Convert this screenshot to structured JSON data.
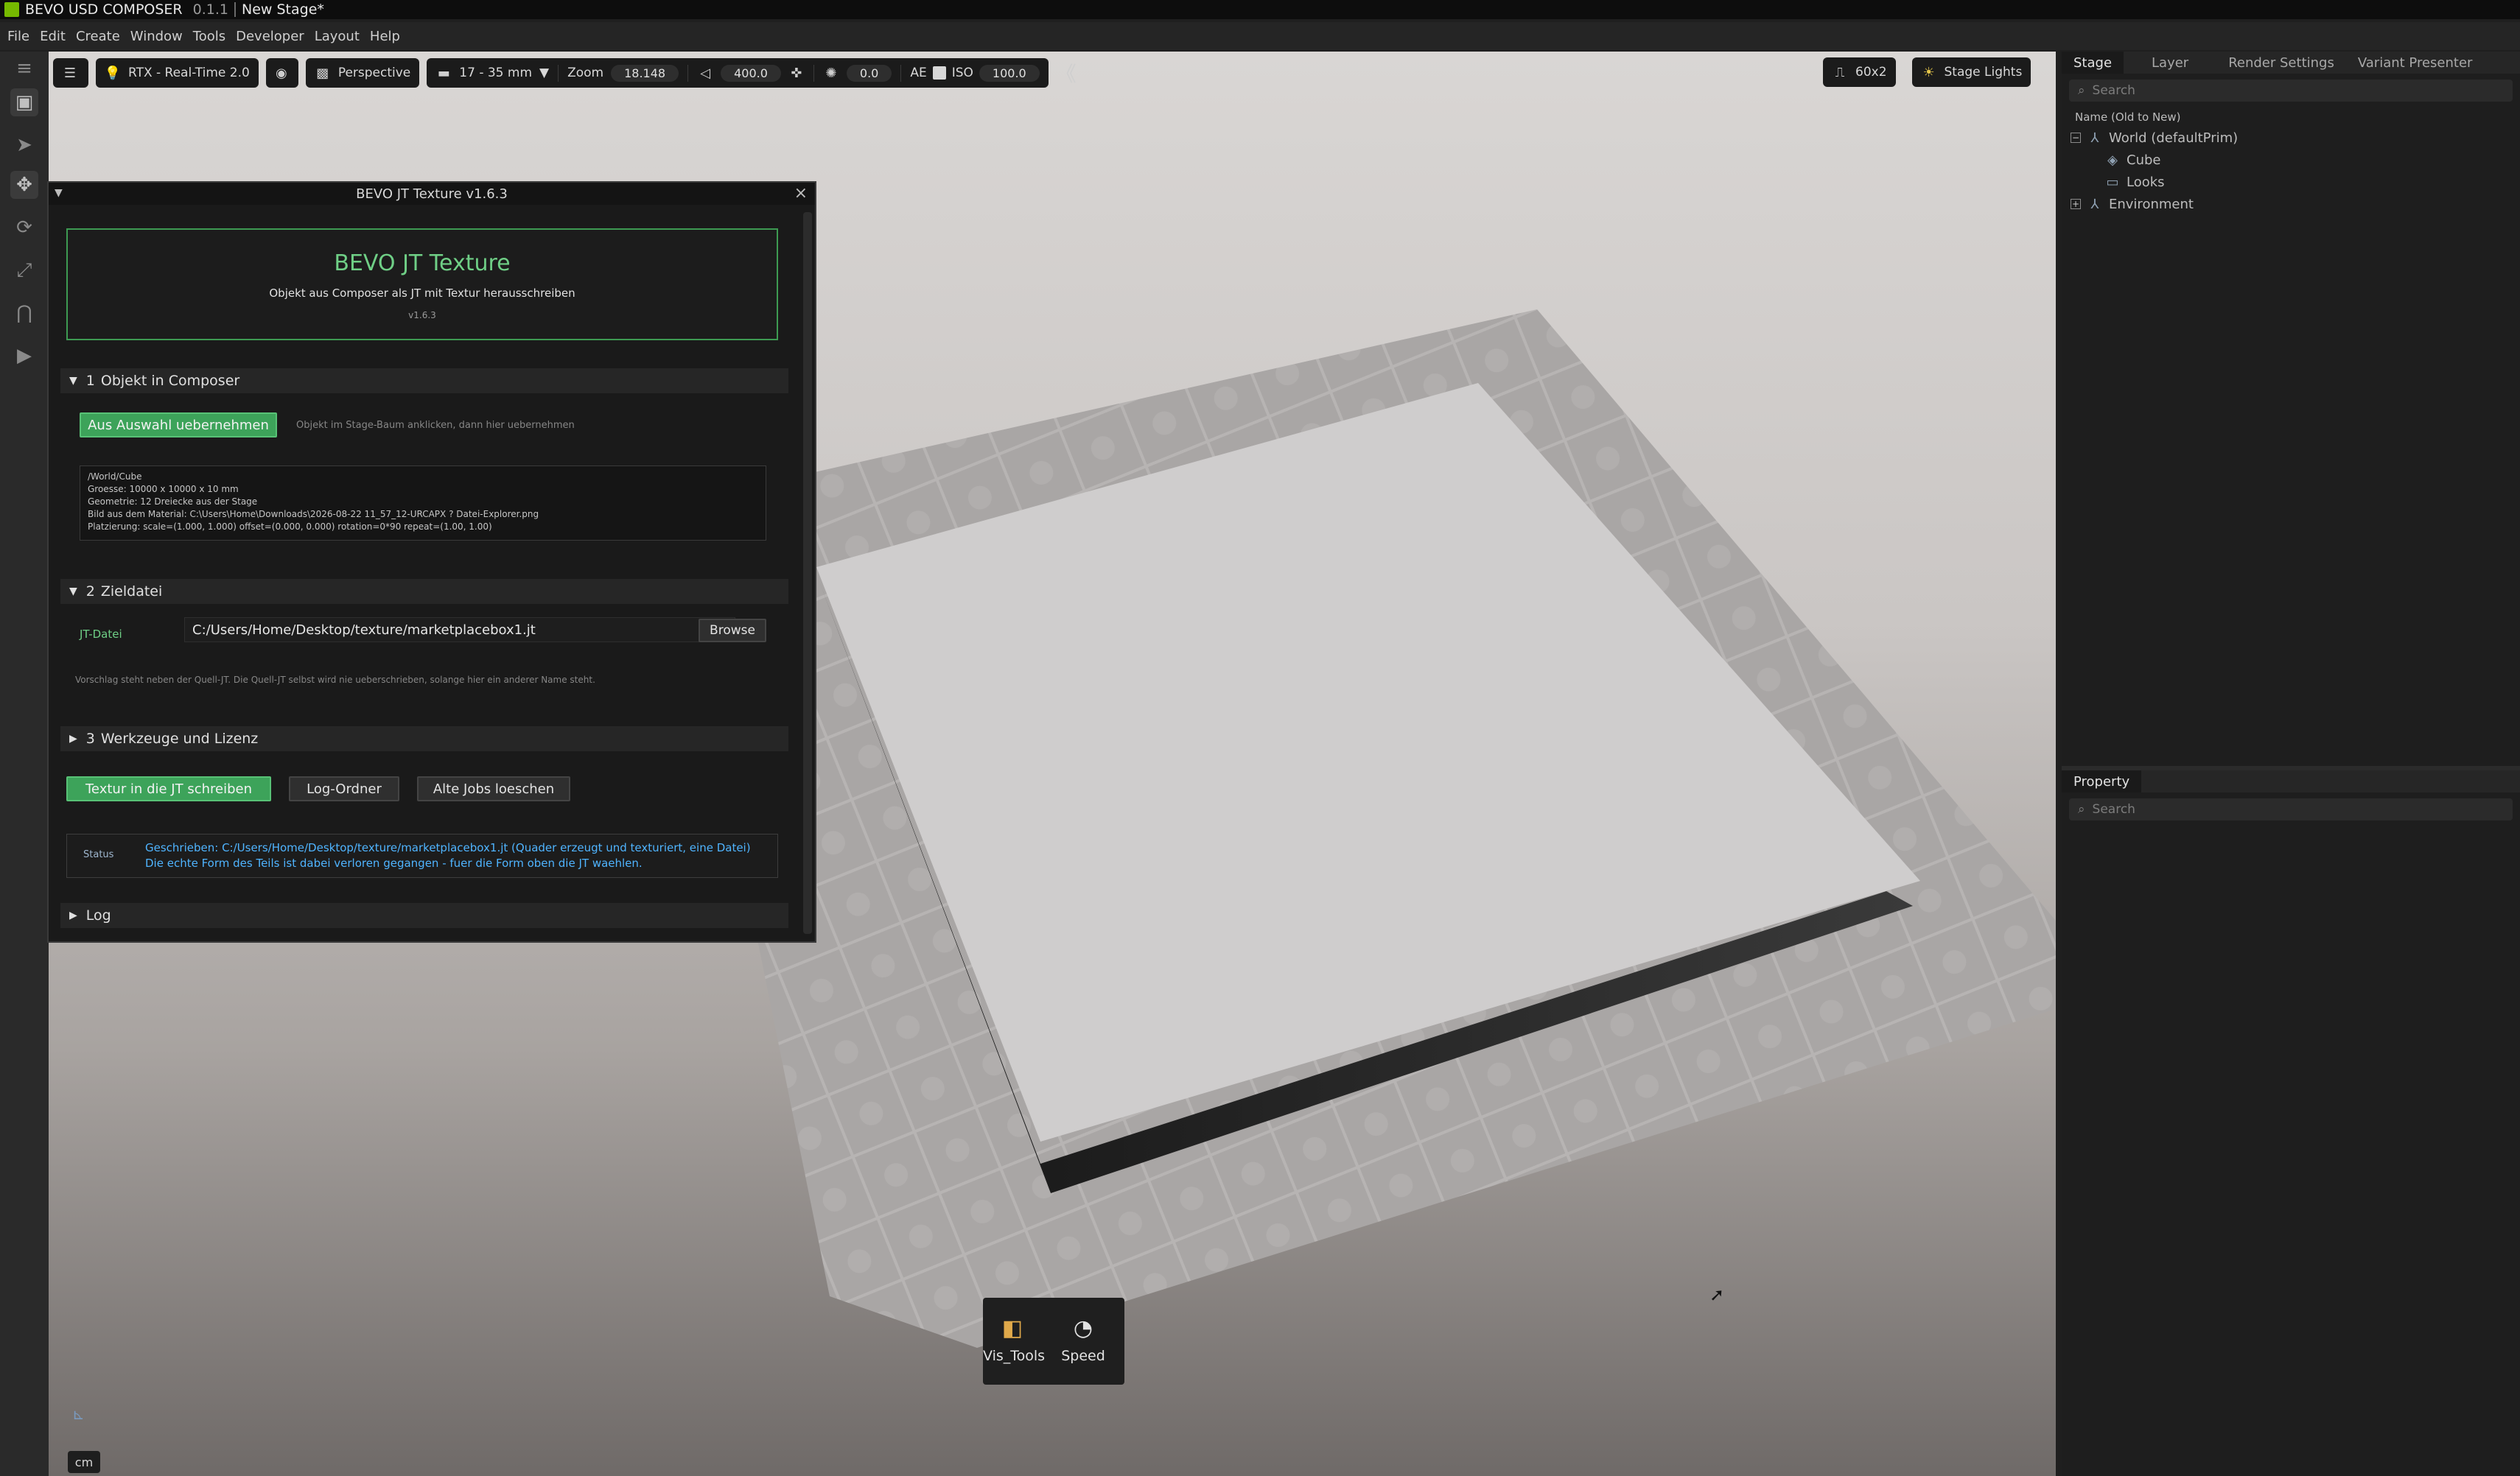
{
  "titlebar": {
    "app_name": "BEVO USD COMPOSER",
    "version": "0.1.1",
    "stage_name": "New Stage*"
  },
  "menubar": {
    "items": [
      "File",
      "Edit",
      "Create",
      "Window",
      "Tools",
      "Developer",
      "Layout",
      "Help"
    ]
  },
  "viewport_toolbar": {
    "renderer": "RTX - Real-Time 2.0",
    "camera": "Perspective",
    "lens": "17 - 35 mm",
    "zoom_label": "Zoom",
    "zoom_value": "18.148",
    "far_value": "400.0",
    "exposure_value": "0.0",
    "ae_label": "AE",
    "iso_label": "ISO",
    "iso_value": "100.0",
    "grid_value": "60x2",
    "stage_lights": "Stage Lights"
  },
  "stage_panel": {
    "tabs": [
      "Stage",
      "Layer",
      "Render Settings",
      "Variant Presenter"
    ],
    "search_placeholder": "Search",
    "column_header": "Name (Old to New)",
    "tree": [
      {
        "label": "World (defaultPrim)",
        "expander": "−",
        "icon": "xform-icon"
      },
      {
        "label": "Cube",
        "icon": "cube-icon"
      },
      {
        "label": "Looks",
        "icon": "folder-icon"
      },
      {
        "label": "Environment",
        "expander": "+",
        "icon": "xform-icon"
      }
    ]
  },
  "property_panel": {
    "tab": "Property",
    "search_placeholder": "Search"
  },
  "dialog": {
    "title": "BEVO JT Texture v1.6.3",
    "header_title": "BEVO JT Texture",
    "header_subtitle": "Objekt aus Composer als JT mit Textur herausschreiben",
    "header_version": "v1.6.3",
    "section1": {
      "number": "1",
      "title": "Objekt in Composer"
    },
    "take_selection_button": "Aus Auswahl uebernehmen",
    "take_selection_hint": "Objekt im Stage-Baum anklicken, dann hier uebernehmen",
    "info_lines": [
      "/World/Cube",
      "Groesse: 10000 x 10000 x 10 mm",
      "Geometrie: 12 Dreiecke aus der Stage",
      "Bild aus dem Material: C:\\Users\\Home\\Downloads\\2026-08-22 11_57_12-URCAPX ? Datei-Explorer.png",
      "Platzierung: scale=(1.000, 1.000) offset=(0.000, 0.000) rotation=0*90 repeat=(1.00, 1.00)"
    ],
    "section2": {
      "number": "2",
      "title": "Zieldatei"
    },
    "jt_label": "JT-Datei",
    "jt_path": "C:/Users/Home/Desktop/texture/marketplacebox1.jt",
    "browse_button": "Browse",
    "target_hint": "Vorschlag steht neben der Quell-JT. Die Quell-JT selbst wird nie ueberschrieben, solange hier ein anderer Name steht.",
    "section3": {
      "number": "3",
      "title": "Werkzeuge und Lizenz"
    },
    "write_button": "Textur in die JT schreiben",
    "log_folder_button": "Log-Ordner",
    "delete_jobs_button": "Alte Jobs loeschen",
    "status_label": "Status",
    "status_text": "Geschrieben: C:/Users/Home/Desktop/texture/marketplacebox1.jt (Quader erzeugt und texturiert, eine Datei)  Die echte Form des Teils ist dabei verloren gegangen - fuer die Form oben die JT waehlen.",
    "log_section": "Log"
  },
  "vis_tools": {
    "items": [
      "Vis_Tools",
      "Speed"
    ]
  },
  "units_badge": "cm",
  "colors": {
    "accent_green": "#3da35a",
    "header_green": "#6fcf86",
    "status_blue": "#4fb4ff"
  }
}
